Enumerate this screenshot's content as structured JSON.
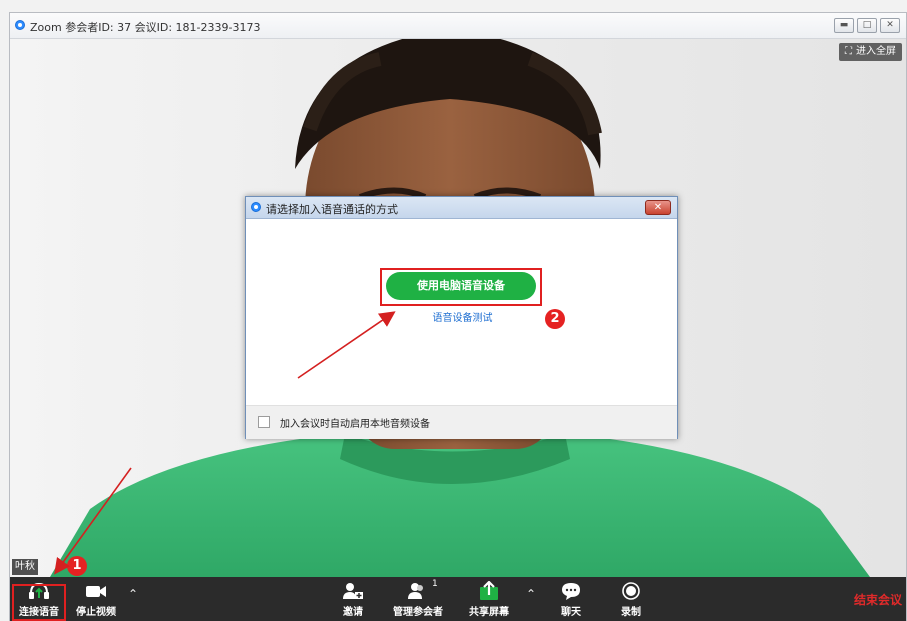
{
  "window": {
    "title": "Zoom 参会者ID: 37   会议ID: 181-2339-3173",
    "controls": [
      "minimize",
      "maximize",
      "close"
    ]
  },
  "video": {
    "fullscreen_label": "进入全屏",
    "participant_name": "叶秋"
  },
  "dialog": {
    "title": "请选择加入语音通话的方式",
    "primary_button": "使用电脑语音设备",
    "test_link": "语音设备测试",
    "checkbox_label": "加入会议时自动启用本地音频设备",
    "checkbox_checked": false
  },
  "toolbar": {
    "join_audio": "连接语音",
    "stop_video": "停止视频",
    "invite": "邀请",
    "manage_participants": "管理参会者",
    "participant_count": "1",
    "share_screen": "共享屏幕",
    "chat": "聊天",
    "record": "录制",
    "end_meeting": "结束会议"
  },
  "annotations": {
    "badge1": "1",
    "badge2": "2"
  },
  "colors": {
    "toolbar_bg": "#2b2b2b",
    "accent_green": "#1fb144",
    "end_red": "#e02a2a",
    "annotation_red": "#e02020",
    "zoom_blue": "#2d8cff"
  }
}
